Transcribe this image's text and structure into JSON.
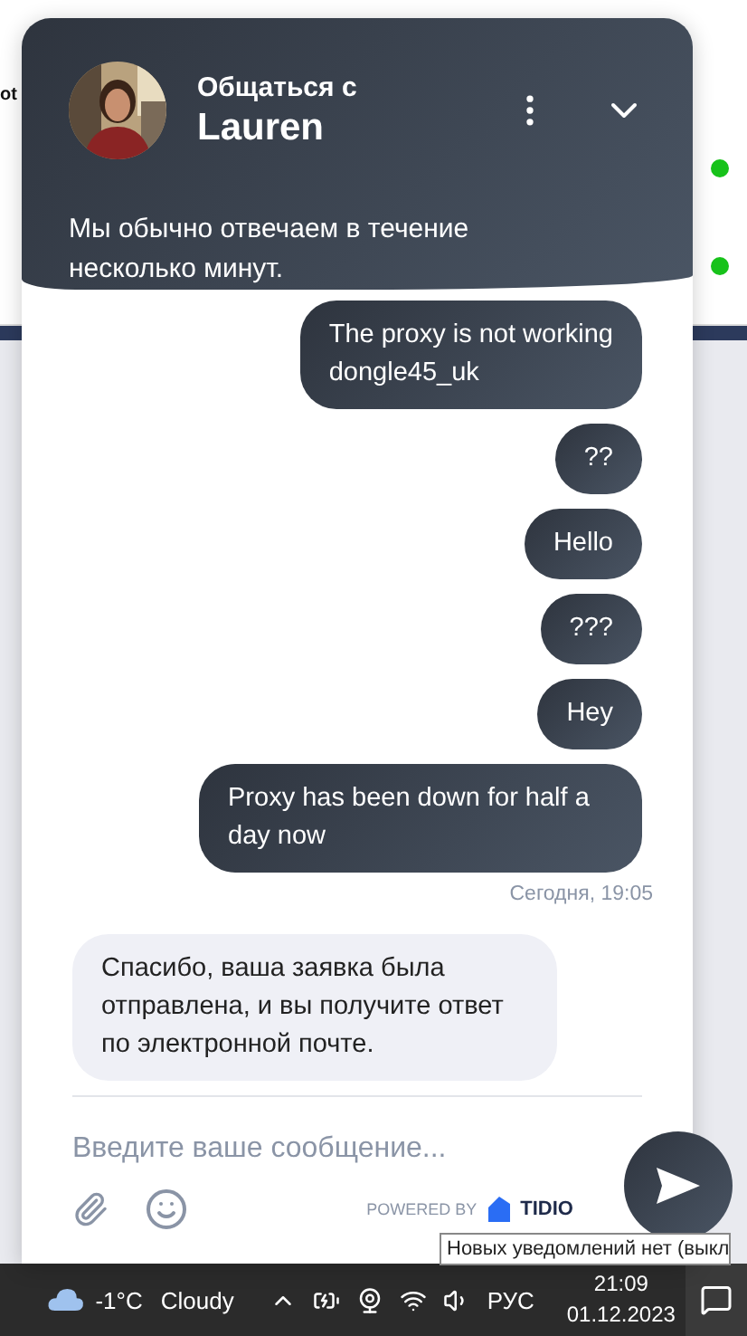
{
  "background_page": {
    "label_fragment": "ot",
    "status_dots": [
      {
        "color": "#17c21a"
      },
      {
        "color": "#17c21a"
      }
    ]
  },
  "chat": {
    "header": {
      "title": "Общаться с",
      "name": "Lauren",
      "subtitle": "Мы обычно отвечаем в течение несколько минут."
    },
    "messages": [
      {
        "kind": "visitor",
        "text": "The proxy is not working\ndongle45_uk"
      },
      {
        "kind": "visitor",
        "text": "??"
      },
      {
        "kind": "visitor",
        "text": "Hello"
      },
      {
        "kind": "visitor",
        "text": "???"
      },
      {
        "kind": "visitor",
        "text": "Hey"
      },
      {
        "kind": "visitor",
        "text": "Proxy has been down for half a day now"
      },
      {
        "kind": "timestamp",
        "text": "Сегодня, 19:05"
      },
      {
        "kind": "operator",
        "text": "Спасибо, ваша заявка была отправлена, и вы получите ответ по электронной почте."
      }
    ],
    "input": {
      "placeholder": "Введите ваше сообщение..."
    },
    "powered_by": "POWERED BY",
    "brand": "TIDIO"
  },
  "tooltip": "Новых уведомлений нет (выкл",
  "taskbar": {
    "temperature": "-1°C",
    "weather": "Cloudy",
    "language": "РУС",
    "time": "21:09",
    "date": "01.12.2023"
  }
}
